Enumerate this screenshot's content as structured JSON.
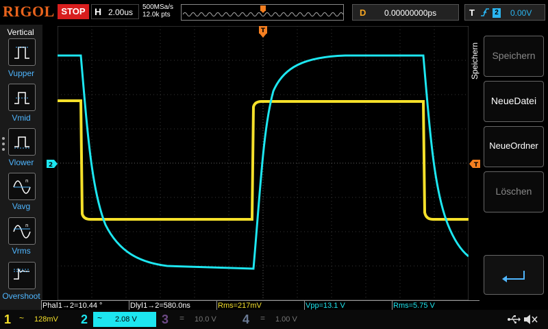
{
  "top": {
    "logo": "RIGOL",
    "run_status": "STOP",
    "horiz_label": "H",
    "timebase": "2.00us",
    "sample_rate": "500MSa/s",
    "memory_depth": "12.0k pts",
    "delay_label": "D",
    "delay_value": "0.00000000ps",
    "trigger_label": "T",
    "trigger_source": "2",
    "trigger_level": "0.00V"
  },
  "left_menu": {
    "title": "Vertical",
    "items": [
      {
        "label": "Vupper",
        "icon": "vupper-icon"
      },
      {
        "label": "Vmid",
        "icon": "vmid-icon"
      },
      {
        "label": "Vlower",
        "icon": "vlower-icon"
      },
      {
        "label": "Vavg",
        "icon": "vavg-icon"
      },
      {
        "label": "Vrms",
        "icon": "vrms-icon"
      },
      {
        "label": "Overshoot",
        "icon": "overshoot-icon"
      }
    ]
  },
  "markers": {
    "trigger_position": "T",
    "ch2_ground": "2",
    "trigger_level_arrow": "T"
  },
  "right_menu": {
    "title": "Speichern",
    "buttons": [
      {
        "label": "Speichern",
        "enabled": false
      },
      {
        "label": "NeueDatei",
        "enabled": true
      },
      {
        "label": "NeueOrdner",
        "enabled": true
      },
      {
        "label": "Löschen",
        "enabled": false
      }
    ]
  },
  "measurements": [
    {
      "text": "PhaⅠ1→2=10.44 °",
      "color": "#ffffff"
    },
    {
      "text": "DlyⅠ1→2=580.0ns",
      "color": "#ffffff"
    },
    {
      "text": "Rms=217mV",
      "color": "#f5e02a"
    },
    {
      "text": "Vpp=13.1 V",
      "color": "#1de6f0"
    },
    {
      "text": "Rms=5.75 V",
      "color": "#1de6f0"
    }
  ],
  "channels": [
    {
      "num": "1",
      "scale": "128mV",
      "color": "#f5e02a",
      "active": true
    },
    {
      "num": "2",
      "scale": "2.08 V",
      "color": "#1de6f0",
      "active": true
    },
    {
      "num": "3",
      "scale": "10.0 V",
      "color": "#6e4a86",
      "active": false
    },
    {
      "num": "4",
      "scale": "1.00 V",
      "color": "#6a7a94",
      "active": false
    }
  ],
  "colors": {
    "ch1": "#f5e02a",
    "ch2": "#1de6f0",
    "trigger_marker": "#f57f20",
    "accent_blue": "#4fb6ff"
  }
}
